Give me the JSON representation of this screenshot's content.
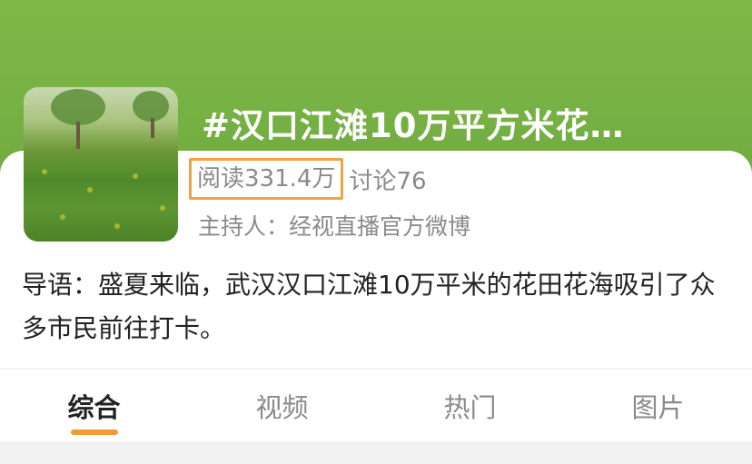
{
  "header": {
    "title": "#汉口江滩10万平方米花…",
    "thumbnail_icon": "flower-field-photo"
  },
  "stats": {
    "read_label": "阅读331.4万",
    "discuss_label": "讨论76"
  },
  "host": "主持人：经视直播官方微博",
  "intro": "导语：盛夏来临，武汉汉口江滩10万平米的花田花海吸引了众多市民前往打卡。",
  "tabs": [
    {
      "label": "综合",
      "active": true
    },
    {
      "label": "视频",
      "active": false
    },
    {
      "label": "热门",
      "active": false
    },
    {
      "label": "图片",
      "active": false
    }
  ],
  "colors": {
    "hero_green": "#78b345",
    "accent_orange": "#f39a34",
    "highlight_border": "#f0a247",
    "muted_text": "#8a8a8a"
  }
}
